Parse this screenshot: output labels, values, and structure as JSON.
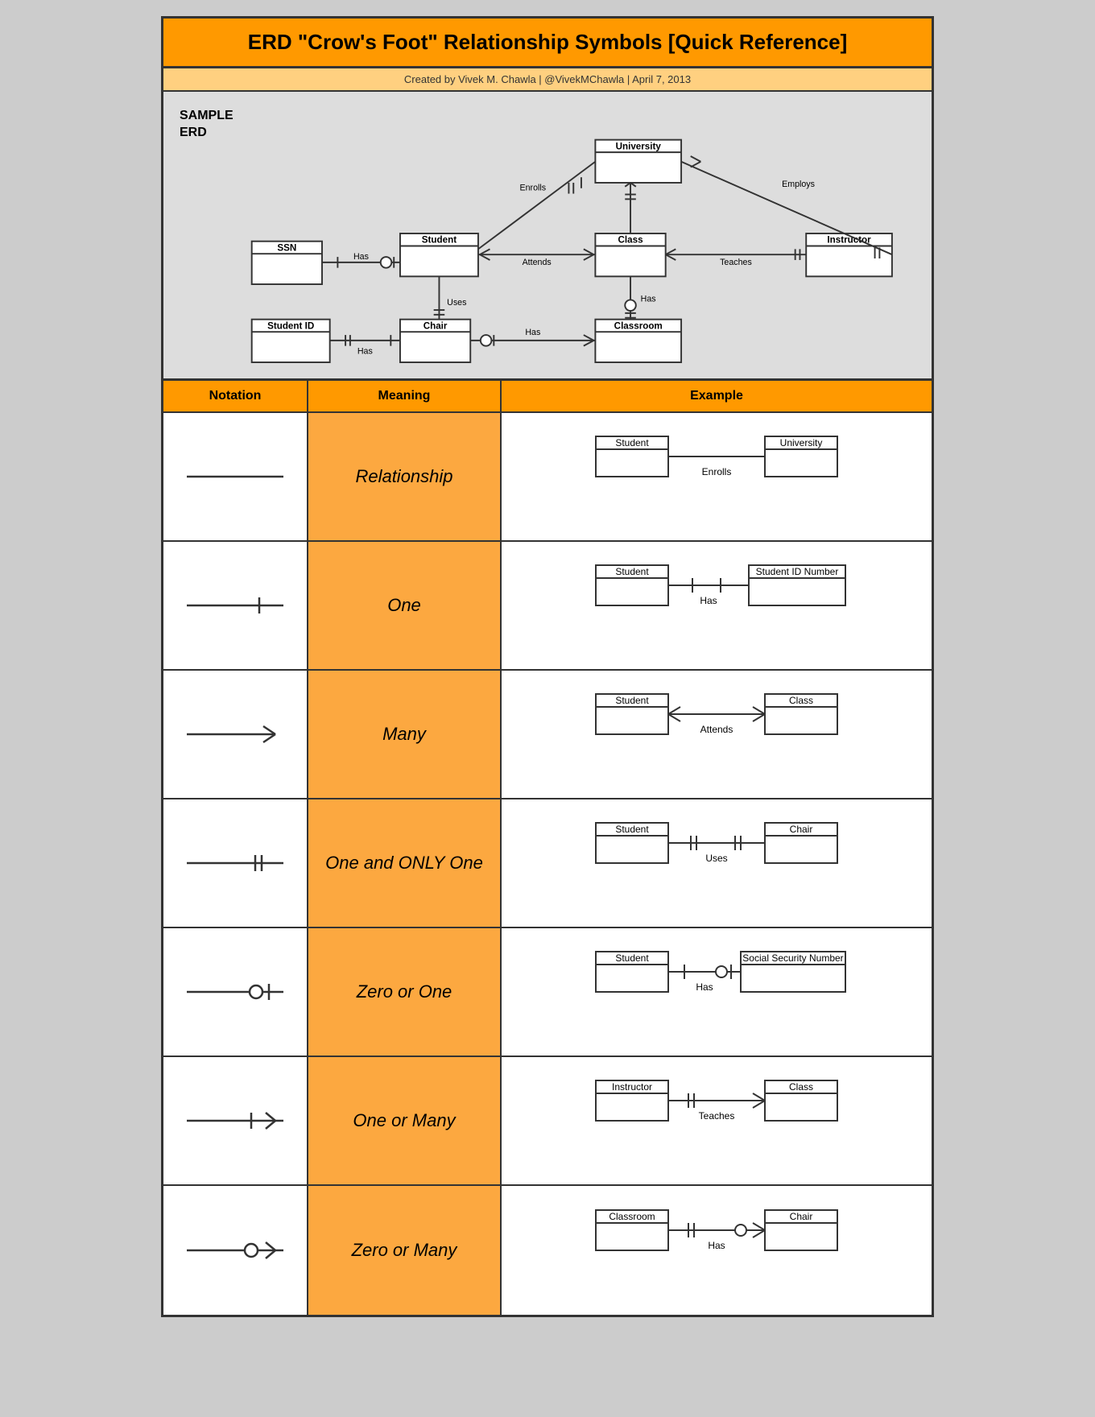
{
  "header": {
    "title": "ERD \"Crow's Foot\" Relationship Symbols [Quick Reference]",
    "subtitle": "Created by Vivek M. Chawla  |  @VivekMChawla  |  April 7, 2013"
  },
  "erd_sample": {
    "label": "SAMPLE\nERD"
  },
  "table_headers": {
    "notation": "Notation",
    "meaning": "Meaning",
    "example": "Example"
  },
  "rows": [
    {
      "meaning": "Relationship",
      "left_entity": "Student",
      "right_entity": "University",
      "relationship": "Enrolls",
      "notation_type": "relationship"
    },
    {
      "meaning": "One",
      "left_entity": "Student",
      "right_entity": "Student ID Number",
      "relationship": "Has",
      "notation_type": "one"
    },
    {
      "meaning": "Many",
      "left_entity": "Student",
      "right_entity": "Class",
      "relationship": "Attends",
      "notation_type": "many"
    },
    {
      "meaning": "One and ONLY One",
      "left_entity": "Student",
      "right_entity": "Chair",
      "relationship": "Uses",
      "notation_type": "one_only"
    },
    {
      "meaning": "Zero or One",
      "left_entity": "Student",
      "right_entity": "Social Security Number",
      "relationship": "Has",
      "notation_type": "zero_or_one"
    },
    {
      "meaning": "One or Many",
      "left_entity": "Instructor",
      "right_entity": "Class",
      "relationship": "Teaches",
      "notation_type": "one_or_many"
    },
    {
      "meaning": "Zero or Many",
      "left_entity": "Classroom",
      "right_entity": "Chair",
      "relationship": "Has",
      "notation_type": "zero_or_many"
    }
  ]
}
